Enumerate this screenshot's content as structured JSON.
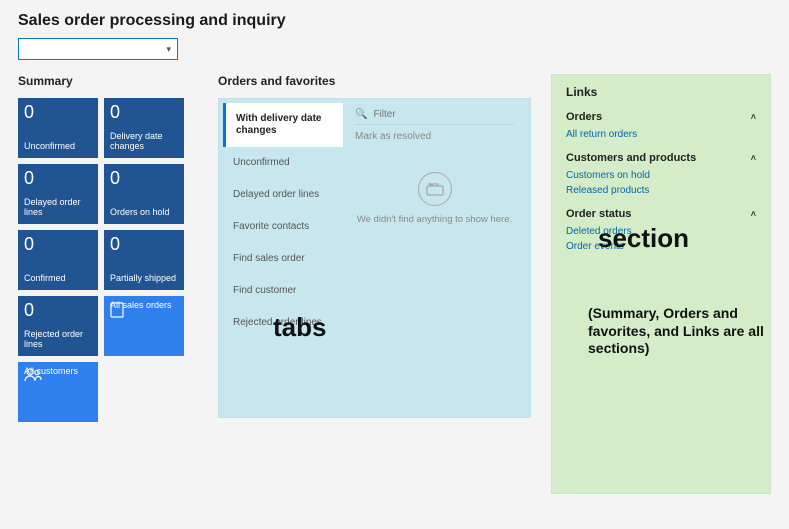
{
  "page_title": "Sales order processing and inquiry",
  "dropdown_value": "",
  "summary": {
    "title": "Summary",
    "tiles": [
      {
        "count": "0",
        "label": "Unconfirmed"
      },
      {
        "count": "0",
        "label": "Delivery date changes"
      },
      {
        "count": "0",
        "label": "Delayed order lines"
      },
      {
        "count": "0",
        "label": "Orders on hold"
      },
      {
        "count": "0",
        "label": "Confirmed"
      },
      {
        "count": "0",
        "label": "Partially shipped"
      },
      {
        "count": "0",
        "label": "Rejected order lines"
      },
      {
        "count": "",
        "label": "All sales orders",
        "icon": "page-icon",
        "style": "light"
      },
      {
        "count": "",
        "label": "All customers",
        "icon": "people-icon",
        "style": "light"
      }
    ]
  },
  "orders": {
    "title": "Orders and favorites",
    "tabs": [
      "With delivery date changes",
      "Unconfirmed",
      "Delayed order lines",
      "Favorite contacts",
      "Find sales order",
      "Find customer",
      "Rejected order lines"
    ],
    "filter_placeholder": "Filter",
    "mark_resolved": "Mark as resolved",
    "empty_text": "We didn't find anything to show here."
  },
  "links": {
    "title": "Links",
    "groups": [
      {
        "header": "Orders",
        "items": [
          "All return orders"
        ]
      },
      {
        "header": "Customers and products",
        "items": [
          "Customers on hold",
          "Released products"
        ]
      },
      {
        "header": "Order status",
        "items": [
          "Deleted orders",
          "Order events"
        ]
      }
    ]
  },
  "annotations": {
    "tabs": "tabs",
    "section": "section",
    "note": "(Summary, Orders and favorites, and Links are all sections)"
  }
}
